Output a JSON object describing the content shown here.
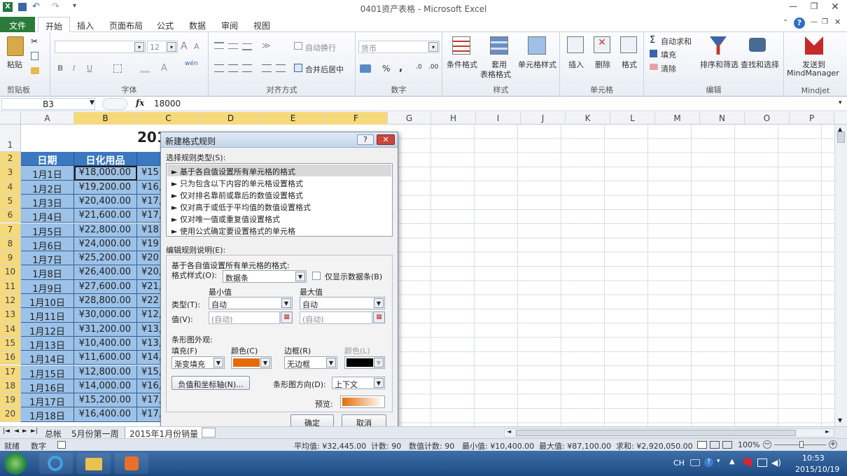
{
  "window": {
    "title": "0401资产表格 - Microsoft Excel"
  },
  "ribbon_tabs": [
    "文件",
    "开始",
    "插入",
    "页面布局",
    "公式",
    "数据",
    "审阅",
    "视图"
  ],
  "ribbon": {
    "clipboard": {
      "label": "剪贴板",
      "paste": "粘贴"
    },
    "font": {
      "label": "字体",
      "size": "12",
      "bold": "B",
      "italic": "I",
      "underline": "U",
      "wen": "wén",
      "grow": "A",
      "shrink": "A"
    },
    "align": {
      "label": "对齐方式",
      "wrap": "自动换行",
      "merge": "合并后居中"
    },
    "number": {
      "label": "数字",
      "format": "货币",
      "pct": "%",
      "comma": ","
    },
    "styles": {
      "label": "样式",
      "cond": "条件格式",
      "table_line1": "套用",
      "table_line2": "表格格式",
      "cell": "单元格样式"
    },
    "cells": {
      "label": "单元格",
      "insert": "插入",
      "delete": "删除",
      "format": "格式"
    },
    "editing": {
      "label": "编辑",
      "autosum": "自动求和",
      "fill": "填充",
      "clear": "清除",
      "sort": "排序和筛选",
      "find": "查找和选择"
    },
    "mindjet": {
      "label": "Mindjet",
      "send_line1": "发送到",
      "send_line2": "MindManager"
    }
  },
  "formula_bar": {
    "name_box": "B3",
    "fx": "fx",
    "value": "18000"
  },
  "columns": [
    "A",
    "B",
    "C",
    "D",
    "E",
    "F",
    "G",
    "H",
    "I",
    "J",
    "K",
    "L",
    "M",
    "N",
    "O",
    "P"
  ],
  "sheet": {
    "title_fragment": "201",
    "headers": [
      "日期",
      "日化用品"
    ],
    "rows": [
      {
        "n": "3",
        "date": "1月1日",
        "b": "¥18,000.00",
        "c": "¥15"
      },
      {
        "n": "4",
        "date": "1月2日",
        "b": "¥19,200.00",
        "c": "¥16,"
      },
      {
        "n": "5",
        "date": "1月3日",
        "b": "¥20,400.00",
        "c": "¥17,"
      },
      {
        "n": "6",
        "date": "1月4日",
        "b": "¥21,600.00",
        "c": "¥17,"
      },
      {
        "n": "7",
        "date": "1月5日",
        "b": "¥22,800.00",
        "c": "¥18"
      },
      {
        "n": "8",
        "date": "1月6日",
        "b": "¥24,000.00",
        "c": "¥19"
      },
      {
        "n": "9",
        "date": "1月7日",
        "b": "¥25,200.00",
        "c": "¥20"
      },
      {
        "n": "10",
        "date": "1月8日",
        "b": "¥26,400.00",
        "c": "¥20,"
      },
      {
        "n": "11",
        "date": "1月9日",
        "b": "¥27,600.00",
        "c": "¥21,"
      },
      {
        "n": "12",
        "date": "1月10日",
        "b": "¥28,800.00",
        "c": "¥22"
      },
      {
        "n": "13",
        "date": "1月11日",
        "b": "¥30,000.00",
        "c": "¥12,"
      },
      {
        "n": "14",
        "date": "1月12日",
        "b": "¥31,200.00",
        "c": "¥13,"
      },
      {
        "n": "15",
        "date": "1月13日",
        "b": "¥10,400.00",
        "c": "¥13,"
      },
      {
        "n": "16",
        "date": "1月14日",
        "b": "¥11,600.00",
        "c": "¥14,"
      },
      {
        "n": "17",
        "date": "1月15日",
        "b": "¥12,800.00",
        "c": "¥15,"
      },
      {
        "n": "18",
        "date": "1月16日",
        "b": "¥14,000.00",
        "c": "¥16,"
      },
      {
        "n": "19",
        "date": "1月17日",
        "b": "¥15,200.00",
        "c": "¥17,"
      },
      {
        "n": "20",
        "date": "1月18日",
        "b": "¥16,400.00",
        "c": "¥17,"
      }
    ],
    "row_numbers_top": [
      "1",
      "2"
    ]
  },
  "dialog": {
    "title": "新建格式规则",
    "help": "?",
    "close": "✕",
    "select_type_label": "选择规则类型(S):",
    "rules": [
      "► 基于各自值设置所有单元格的格式",
      "► 只为包含以下内容的单元格设置格式",
      "► 仅对排名靠前或靠后的数值设置格式",
      "► 仅对高于或低于平均值的数值设置格式",
      "► 仅对唯一值或重复值设置格式",
      "► 使用公式确定要设置格式的单元格"
    ],
    "edit_label": "编辑规则说明(E):",
    "desc": "基于各自值设置所有单元格的格式:",
    "format_style_label": "格式样式(O):",
    "format_style": "数据条",
    "bar_only_label": "仅显示数据条(B)",
    "min_label": "最小值",
    "max_label": "最大值",
    "type_label": "类型(T):",
    "min_type": "自动",
    "max_type": "自动",
    "value_label": "值(V):",
    "min_value": "(自动)",
    "max_value": "(自动)",
    "appearance_label": "条形图外观:",
    "fill_label": "填充(F)",
    "fill_value": "渐变填充",
    "color_label": "颜色(C)",
    "border_label": "边框(R)",
    "border_value": "无边框",
    "border_color_label": "颜色(L)",
    "axis_button": "负值和坐标轴(N)...",
    "direction_label": "条形图方向(D):",
    "direction_value": "上下文",
    "preview_label": "预览:",
    "ok": "确定",
    "cancel": "取消",
    "fill_color": "#e36c09",
    "border_color": "#000000"
  },
  "sheet_tabs": [
    "总帐",
    "5月份第一周",
    "2015年1月份销量"
  ],
  "status": {
    "ready": "就绪",
    "mode": "数字",
    "average": "平均值: ¥32,445.00",
    "count": "计数: 90",
    "num_count": "数值计数: 90",
    "min": "最小值: ¥10,400.00",
    "max": "最大值: ¥87,100.00",
    "sum": "求和: ¥2,920,050.00",
    "zoom": "100%"
  },
  "taskbar": {
    "lang": "CH",
    "time": "10:53",
    "date": "2015/10/19"
  }
}
